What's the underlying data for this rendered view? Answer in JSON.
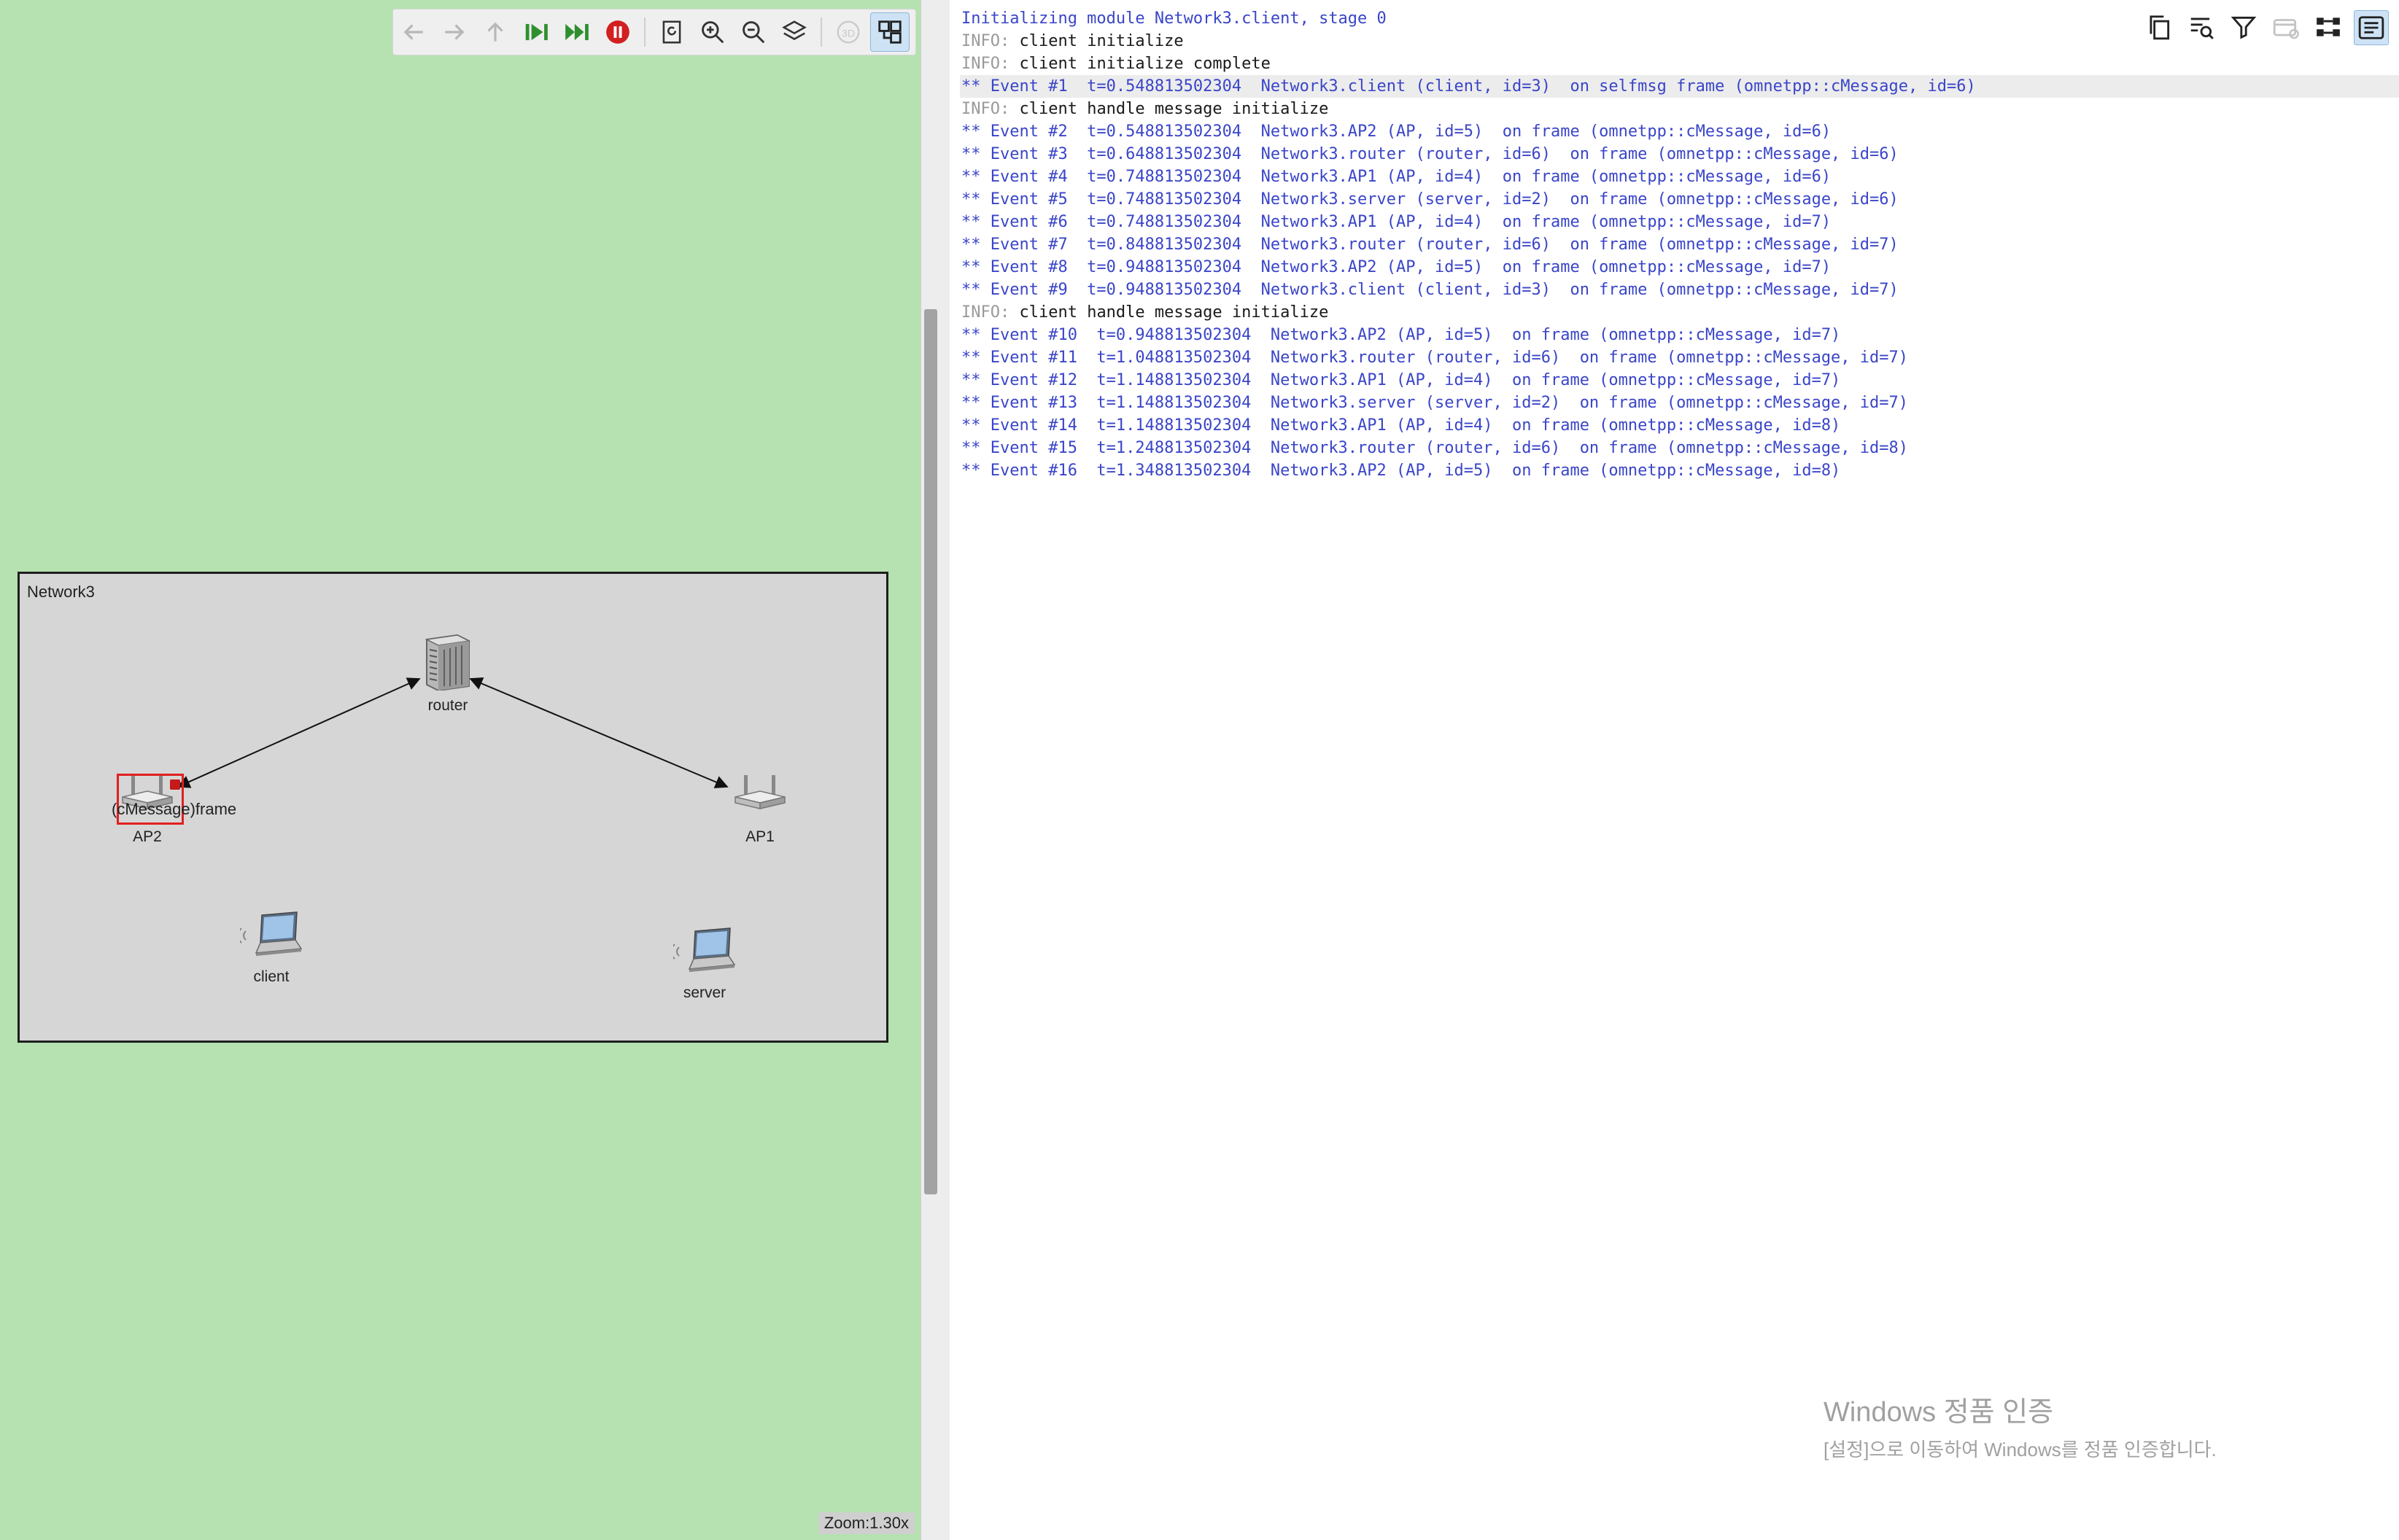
{
  "network": {
    "title": "Network3",
    "nodes": {
      "router": "router",
      "ap2": "AP2",
      "ap1": "AP1",
      "client": "client",
      "server": "server"
    },
    "message_label": "(cMessage)frame"
  },
  "zoom": "Zoom:1.30x",
  "toolbar": {
    "items": [
      "back-icon",
      "forward-icon",
      "up-icon",
      "step-icon",
      "fast-run-icon",
      "stop-icon",
      "refresh-layout-icon",
      "zoom-in-icon",
      "zoom-out-icon",
      "layers-icon",
      "3d-icon",
      "module-view-icon"
    ],
    "three_d_label": "3D"
  },
  "log_toolbar": {
    "items": [
      "copy-icon",
      "find-icon",
      "filter-icon",
      "messages-icon",
      "layout-icon",
      "log-view-icon"
    ]
  },
  "log": {
    "lines": [
      {
        "kind": "init",
        "prefix": "",
        "text": "Initializing module Network3.client, stage 0"
      },
      {
        "kind": "info",
        "prefix": "INFO:",
        "text": " client initialize"
      },
      {
        "kind": "info",
        "prefix": "INFO:",
        "text": " client initialize complete"
      },
      {
        "kind": "event",
        "prefix": "",
        "text": "** Event #1  t=0.548813502304  Network3.client (client, id=3)  on selfmsg frame (omnetpp::cMessage, id=6)"
      },
      {
        "kind": "info",
        "prefix": "INFO:",
        "text": " client handle message initialize"
      },
      {
        "kind": "event",
        "prefix": "",
        "text": "** Event #2  t=0.548813502304  Network3.AP2 (AP, id=5)  on frame (omnetpp::cMessage, id=6)"
      },
      {
        "kind": "event",
        "prefix": "",
        "text": "** Event #3  t=0.648813502304  Network3.router (router, id=6)  on frame (omnetpp::cMessage, id=6)"
      },
      {
        "kind": "event",
        "prefix": "",
        "text": "** Event #4  t=0.748813502304  Network3.AP1 (AP, id=4)  on frame (omnetpp::cMessage, id=6)"
      },
      {
        "kind": "event",
        "prefix": "",
        "text": "** Event #5  t=0.748813502304  Network3.server (server, id=2)  on frame (omnetpp::cMessage, id=6)"
      },
      {
        "kind": "event",
        "prefix": "",
        "text": "** Event #6  t=0.748813502304  Network3.AP1 (AP, id=4)  on frame (omnetpp::cMessage, id=7)"
      },
      {
        "kind": "event",
        "prefix": "",
        "text": "** Event #7  t=0.848813502304  Network3.router (router, id=6)  on frame (omnetpp::cMessage, id=7)"
      },
      {
        "kind": "event",
        "prefix": "",
        "text": "** Event #8  t=0.948813502304  Network3.AP2 (AP, id=5)  on frame (omnetpp::cMessage, id=7)"
      },
      {
        "kind": "event",
        "prefix": "",
        "text": "** Event #9  t=0.948813502304  Network3.client (client, id=3)  on frame (omnetpp::cMessage, id=7)"
      },
      {
        "kind": "info",
        "prefix": "INFO:",
        "text": " client handle message initialize"
      },
      {
        "kind": "event",
        "prefix": "",
        "text": "** Event #10  t=0.948813502304  Network3.AP2 (AP, id=5)  on frame (omnetpp::cMessage, id=7)"
      },
      {
        "kind": "event",
        "prefix": "",
        "text": "** Event #11  t=1.048813502304  Network3.router (router, id=6)  on frame (omnetpp::cMessage, id=7)"
      },
      {
        "kind": "event",
        "prefix": "",
        "text": "** Event #12  t=1.148813502304  Network3.AP1 (AP, id=4)  on frame (omnetpp::cMessage, id=7)"
      },
      {
        "kind": "event",
        "prefix": "",
        "text": "** Event #13  t=1.148813502304  Network3.server (server, id=2)  on frame (omnetpp::cMessage, id=7)"
      },
      {
        "kind": "event",
        "prefix": "",
        "text": "** Event #14  t=1.148813502304  Network3.AP1 (AP, id=4)  on frame (omnetpp::cMessage, id=8)"
      },
      {
        "kind": "event",
        "prefix": "",
        "text": "** Event #15  t=1.248813502304  Network3.router (router, id=6)  on frame (omnetpp::cMessage, id=8)"
      },
      {
        "kind": "event",
        "prefix": "",
        "text": "** Event #16  t=1.348813502304  Network3.AP2 (AP, id=5)  on frame (omnetpp::cMessage, id=8)"
      }
    ],
    "highlighted_line": 3
  },
  "watermark": {
    "title": "Windows 정품 인증",
    "subtitle": "[설정]으로 이동하여 Windows를 정품 인증합니다."
  },
  "colors": {
    "canvas_bg": "#b5e2b0",
    "network_bg": "#d6d6d6",
    "event_text": "#3a45c8",
    "message_highlight": "#e02020"
  }
}
